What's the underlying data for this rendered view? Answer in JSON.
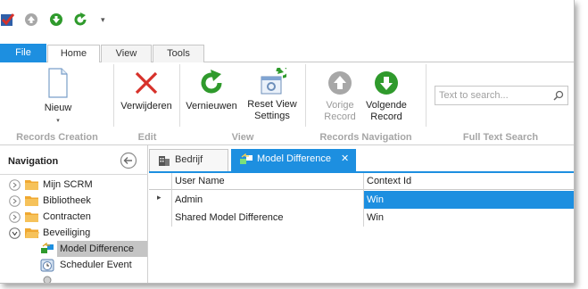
{
  "quick_access": {
    "items": [
      "app-icon",
      "undo-icon",
      "forward-icon",
      "refresh-icon",
      "customize-icon"
    ],
    "customize_glyph": "▾"
  },
  "tabs": {
    "file": "File",
    "home": "Home",
    "view": "View",
    "tools": "Tools"
  },
  "ribbon": {
    "nieuw": "Nieuw",
    "verwijderen": "Verwijderen",
    "vernieuwen": "Vernieuwen",
    "reset_view_line1": "Reset View",
    "reset_view_line2": "Settings",
    "vorige_line1": "Vorige",
    "vorige_line2": "Record",
    "volgende_line1": "Volgende",
    "volgende_line2": "Record",
    "search_placeholder": "Text to search...",
    "groups": {
      "records_creation": "Records Creation",
      "edit": "Edit",
      "view": "View",
      "records_navigation": "Records Navigation",
      "full_text_search": "Full Text Search"
    }
  },
  "navigation": {
    "title": "Navigation",
    "items": [
      {
        "label": "Mijn SCRM"
      },
      {
        "label": "Bibliotheek"
      },
      {
        "label": "Contracten"
      },
      {
        "label": "Beveiliging"
      },
      {
        "label": "Model Difference"
      },
      {
        "label": "Scheduler Event"
      }
    ]
  },
  "documents": {
    "tabs": [
      {
        "label": "Bedrijf"
      },
      {
        "label": "Model Difference"
      }
    ],
    "close_glyph": "✕"
  },
  "grid": {
    "columns": [
      "User Name",
      "Context Id"
    ],
    "rows": [
      {
        "user_name": "Admin",
        "context_id": "Win"
      },
      {
        "user_name": "Shared Model Difference",
        "context_id": "Win"
      }
    ],
    "row_indicator": "▸"
  },
  "colors": {
    "accent": "#1d8fe0",
    "selected_nav": "#c4c4c4",
    "disabled_text": "#9a9a9a",
    "group_label": "#a6a6a6",
    "folder": "#f0a830",
    "green": "#3aa335",
    "red": "#d7312a"
  }
}
